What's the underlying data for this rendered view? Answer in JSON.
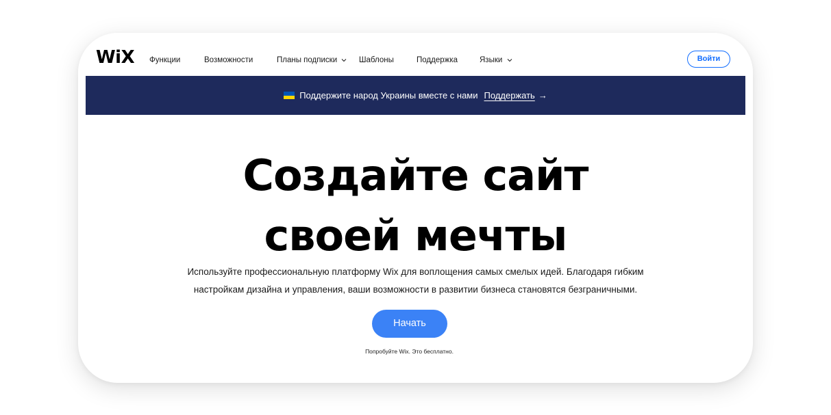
{
  "header": {
    "logo": "WiX",
    "nav": [
      {
        "label": "Функции",
        "has_dropdown": false
      },
      {
        "label": "Возможности",
        "has_dropdown": false
      },
      {
        "label": "Планы подписки",
        "has_dropdown": true
      },
      {
        "label": "Шаблоны",
        "has_dropdown": false
      },
      {
        "label": "Поддержка",
        "has_dropdown": false
      },
      {
        "label": "Языки",
        "has_dropdown": true
      }
    ],
    "login_label": "Войти"
  },
  "banner": {
    "text": "Поддержите народ Украины вместе с нами",
    "link_label": "Поддержать",
    "arrow": "→",
    "flag_colors": [
      "#0057b7",
      "#ffd700"
    ],
    "background": "#1e2a5c"
  },
  "hero": {
    "title_line1": "Создайте сайт",
    "title_line2": "своей мечты",
    "subtitle_line1": "Используйте профессиональную платформу Wix для воплощения самых смелых идей. Благодаря гибким",
    "subtitle_line2": "настройкам дизайна и управления, ваши возможности в развитии бизнеса становятся безграничными.",
    "cta_label": "Начать",
    "note": "Попробуйте Wix. Это бесплатно."
  },
  "colors": {
    "accent": "#116dff",
    "cta": "#3b82f6"
  }
}
